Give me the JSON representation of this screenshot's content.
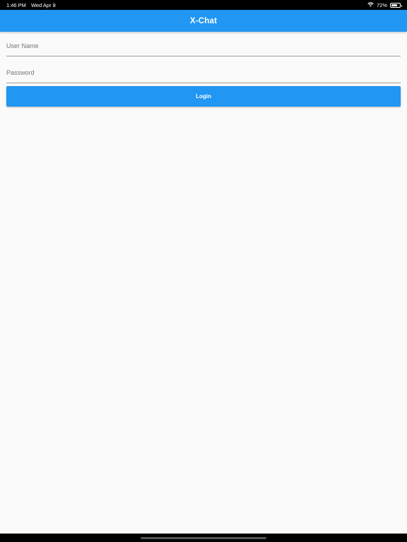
{
  "status_bar": {
    "time": "1:46 PM",
    "date": "Wed Apr 8",
    "battery_percent": "72%",
    "battery_level": 0.72,
    "icons": [
      "wifi-icon",
      "battery-icon"
    ]
  },
  "app_bar": {
    "title": "X-Chat",
    "color": "#2196f3"
  },
  "form": {
    "username_placeholder": "User Name",
    "username_value": "",
    "password_placeholder": "Password",
    "password_value": "",
    "login_label": "Login"
  }
}
